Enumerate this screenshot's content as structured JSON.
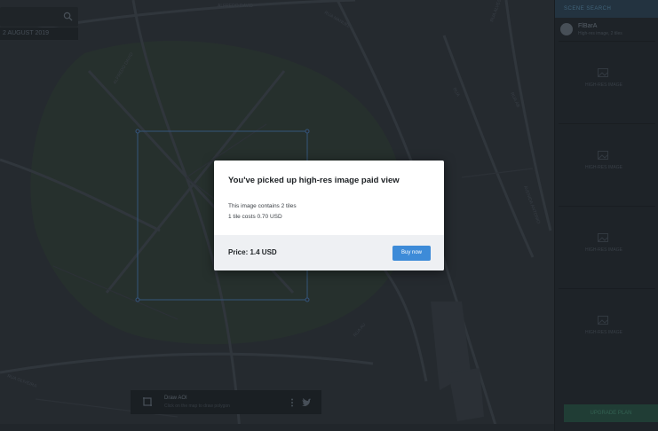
{
  "colors": {
    "map_bg": "#2b3036",
    "map_road": "#3a4047",
    "selection": "#3f6b9a",
    "buy_button": "#3d8bd8"
  },
  "map": {
    "labels": [
      "ALFREDO DAVID",
      "ALFREDO DAVID",
      "RUA MANUEL",
      "RUA ALVES",
      "RUA",
      "RUA AB",
      "AVENIDA ANTONIO",
      "RUA OLIVEIRA",
      "RUA AU"
    ]
  },
  "search": {
    "icon": "search-icon",
    "date_text": "2 AUGUST 2019"
  },
  "sidebar": {
    "header": "SCENE SEARCH",
    "user_name": "FlBarA",
    "user_sub": "High-res image, 2 tiles",
    "tiles": [
      {
        "icon": "image-icon",
        "label": "HIGH-RES IMAGE"
      },
      {
        "icon": "image-icon",
        "label": "HIGH-RES IMAGE"
      },
      {
        "icon": "image-icon",
        "label": "HIGH-RES IMAGE"
      },
      {
        "icon": "image-icon",
        "label": "HIGH-RES IMAGE"
      }
    ],
    "upgrade_button": "UPGRADE PLAN"
  },
  "bottom_bar": {
    "title": "Draw AOI",
    "subtitle": "Click on the map to draw polygon",
    "icons": [
      "crop-icon",
      "more-vertical-icon",
      "twitter-icon"
    ]
  },
  "status_strip": "",
  "modal": {
    "title": "You've picked up high-res image paid view",
    "line1": "This image contains 2 tiles",
    "line2": "1 tile costs 0.70 USD",
    "price": "Price: 1.4 USD",
    "buy_label": "Buy now"
  }
}
